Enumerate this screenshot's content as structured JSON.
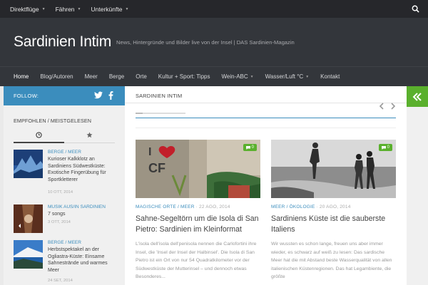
{
  "topnav": {
    "items": [
      "Direktflüge",
      "Fähren",
      "Unterkünfte"
    ],
    "search_icon": "search-icon"
  },
  "header": {
    "title": "Sardinien Intim",
    "description": "News, Hintergründe und Bilder live von der Insel | DAS Sardinien-Magazin"
  },
  "mainnav": {
    "items": [
      "Home",
      "Blog/Autoren",
      "Meer",
      "Berge",
      "Orte",
      "Kultur + Sport: Tipps",
      "Wein-ABC",
      "Wasser/Luft °C",
      "Kontakt"
    ]
  },
  "sidebar": {
    "follow_label": "FOLLOW:",
    "social": [
      "twitter-icon",
      "facebook-icon"
    ],
    "widget_title": "EMPFOHLEN / MEISTGELESEN",
    "tabs": [
      "clock-icon",
      "star-icon"
    ],
    "posts": [
      {
        "category": "BERGE / MEER",
        "title": "Kurioser Kalkklotz an Sardiniens Südwestküste: Exotische Fingerübung für Sportkletterer",
        "date": "10 OTT, 2014"
      },
      {
        "category": "MUSIK AUS/IN SARDINIEN",
        "title": "7 songs",
        "date": "3 OTT, 2014"
      },
      {
        "category": "BERGE / MEER",
        "title": "Herbstspektakel an der Ogliastra-Küste: Einsame Sahnestrände und warmes Meer",
        "date": "24 SET, 2014"
      }
    ]
  },
  "content": {
    "breadcrumb": "SARDINIEN INTIM",
    "posts": [
      {
        "category": "MAGISCHE ORTE / MEER",
        "date": "22 AGO, 2014",
        "comments": "0",
        "title": "Sahne-Segeltörn um die Isola di San Pietro: Sardinien im Kleinformat",
        "excerpt": "L'isola dell'isola dell'penisola nennen die Carlofortini ihre Insel, die 'Insel der Insel der Halbinsel'. Die Isola di San Pietro ist ein Ort von nur 54 Quadratkilometer vor der Südwestküste der Mutterinsel – und dennoch etwas Besonderes..."
      },
      {
        "category": "MEER / ÖKOLOGIE",
        "date": "20 AGO, 2014",
        "comments": "0",
        "title": "Sardiniens Küste ist die sauberste Italiens",
        "excerpt": "Wir wussten es schon lange, freuen uns aber immer wieder, es schwarz auf weiß zu lesen: Das sardische Meer hat die mit Abstand beste Wasserqualität von allen italienischen Küstenregionen. Das hat Legambiente, die größte"
      }
    ]
  },
  "right_toggle": {
    "icon": "double-chevron-left-icon"
  },
  "colors": {
    "accent": "#3b8dbd",
    "green": "#5ab02d",
    "header": "#33363b",
    "topbar": "#26272b"
  }
}
